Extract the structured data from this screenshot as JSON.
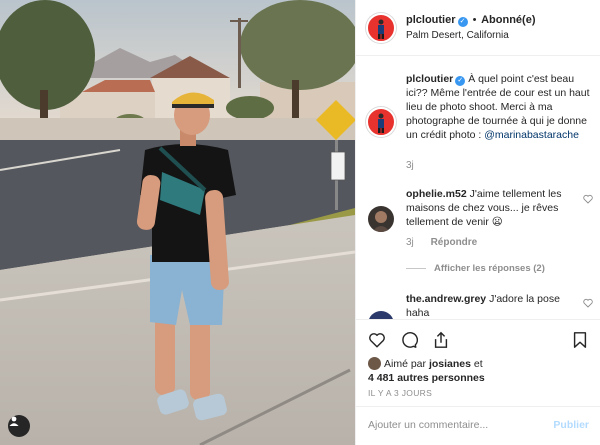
{
  "post": {
    "username": "plcloutier",
    "follow_status": "Abonné(e)",
    "separator": "•",
    "location": "Palm Desert, California",
    "verified_mark": "✓"
  },
  "caption": {
    "username": "plcloutier",
    "text": "À quel point c'est beau ici?? Même l'entrée de cour est un haut lieu de photo shoot. Merci à ma photographe de tournée à qui je donne un crédit photo : ",
    "mention": "@marinabastarache",
    "time": "3j"
  },
  "comments": [
    {
      "username": "ophelie.m52",
      "text": "J'aime tellement les maisons de chez vous... je rêves tellement de venir 😦",
      "time": "3j",
      "reply_label": "Répondre"
    },
    {
      "username": "the.andrew.grey",
      "text": "J'adore la pose haha"
    }
  ],
  "view_replies_label": "Afficher les réponses (2)",
  "likes": {
    "prefix": "Aimé par ",
    "first_liker": "josianes",
    "conjunction": " et",
    "others": "4 481 autres personnes"
  },
  "date_label": "IL Y A 3 JOURS",
  "comment_box": {
    "placeholder": "Ajouter un commentaire...",
    "submit_label": "Publier"
  },
  "colors": {
    "verified": "#3897f0",
    "avatar_bg": "#e8322e",
    "publish_disabled": "#b3dbff",
    "secondary_text": "#8e8e8e"
  },
  "icons": [
    "heart-icon",
    "comment-icon",
    "share-icon",
    "bookmark-icon",
    "user-tag-icon",
    "small-heart-icon"
  ]
}
